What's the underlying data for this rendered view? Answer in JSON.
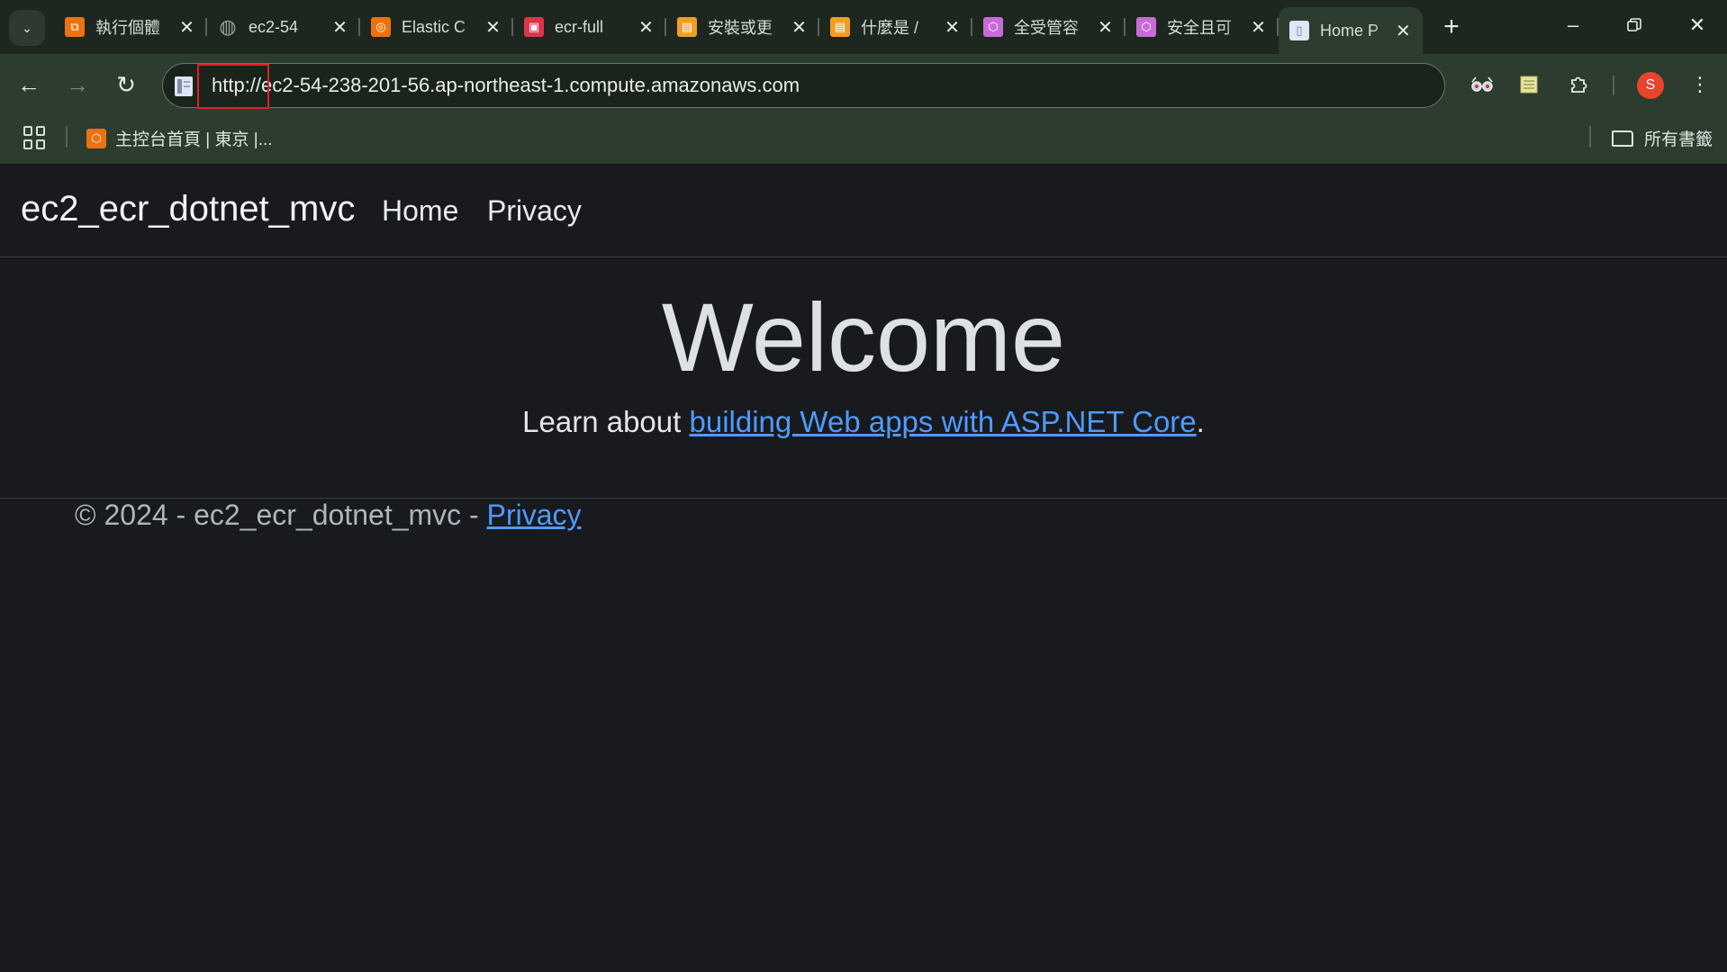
{
  "browser": {
    "tabs": [
      {
        "title": "執行個體",
        "icon_name": "aws-ec2-icon",
        "icon_color": "#ec7211",
        "active": false
      },
      {
        "title": "ec2-54",
        "icon_name": "globe-icon",
        "icon_color": "#9aa3a0",
        "active": false
      },
      {
        "title": "Elastic C",
        "icon_name": "aws-ecr-icon",
        "icon_color": "#ec7211",
        "active": false
      },
      {
        "title": "ecr-full",
        "icon_name": "aws-ecr-repo-icon",
        "icon_color": "#dd344c",
        "active": false
      },
      {
        "title": "安裝或更",
        "icon_name": "aws-docs-icon",
        "icon_color": "#f0a020",
        "active": false
      },
      {
        "title": "什麼是 /",
        "icon_name": "aws-docs-icon",
        "icon_color": "#f0a020",
        "active": false
      },
      {
        "title": "全受管容",
        "icon_name": "cube-icon",
        "icon_color": "#c86bd8",
        "active": false
      },
      {
        "title": "安全且可",
        "icon_name": "cube-icon",
        "icon_color": "#c86bd8",
        "active": false
      },
      {
        "title": "Home P",
        "icon_name": "page-icon",
        "icon_color": "#dfe6f5",
        "active": true
      }
    ],
    "url": {
      "scheme": "http://",
      "host": "ec2-54-238-201-56.ap-northeast-1.compute.amazonaws.com"
    },
    "profile_initial": "S",
    "bookmarks": [
      {
        "label": "主控台首頁 | 東京 |..."
      }
    ],
    "all_bookmarks_label": "所有書籤"
  },
  "site": {
    "brand": "ec2_ecr_dotnet_mvc",
    "nav": [
      {
        "label": "Home"
      },
      {
        "label": "Privacy"
      }
    ],
    "heading": "Welcome",
    "learn_prefix": "Learn about ",
    "learn_link": "building Web apps with ASP.NET Core",
    "learn_suffix": ".",
    "footer_text": "© 2024 - ec2_ecr_dotnet_mvc - ",
    "footer_link": "Privacy"
  },
  "colors": {
    "page_bg": "#181a1d",
    "link": "#4e9bff",
    "highlight": "#e0202a",
    "chrome": "#2c3c2e"
  }
}
